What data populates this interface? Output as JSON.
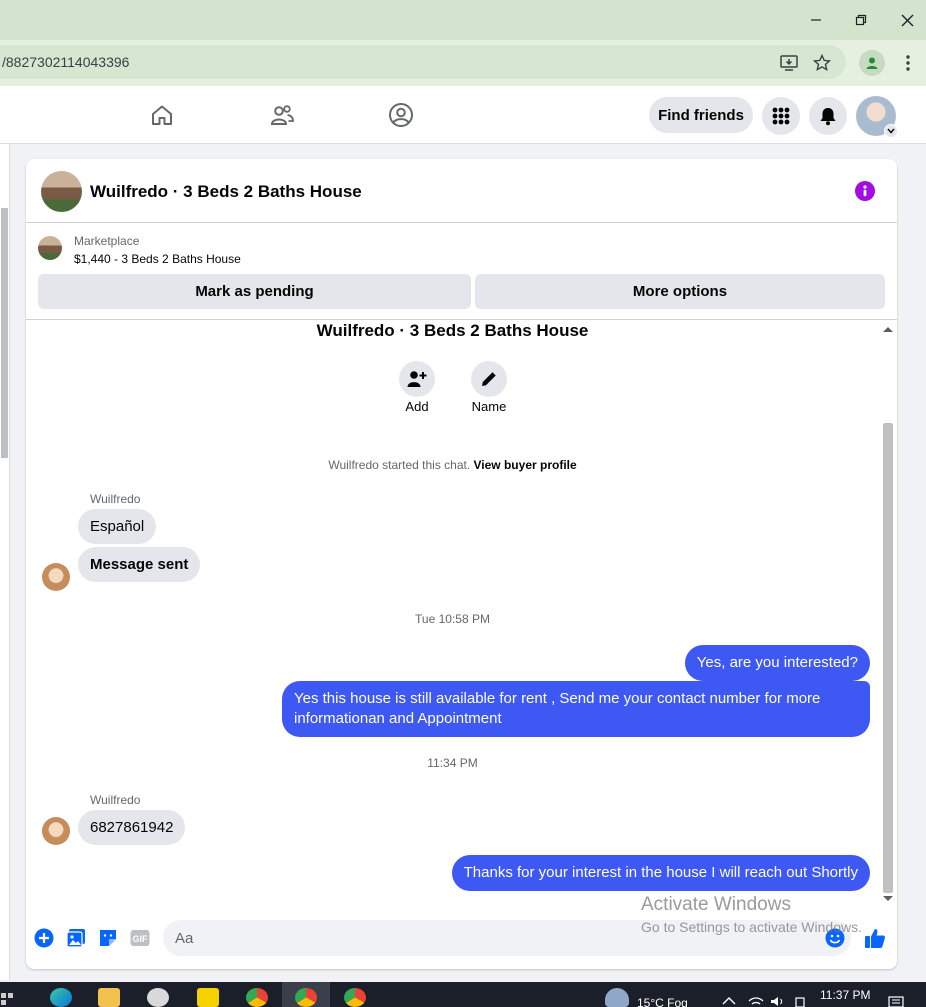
{
  "browser": {
    "url": "/8827302114043396"
  },
  "nav": {
    "find_friends": "Find friends"
  },
  "chat": {
    "title": "Wuilfredo · 3 Beds 2 Baths House",
    "marketplace_label": "Marketplace",
    "listing": "$1,440 - 3 Beds 2 Baths House",
    "mark_pending": "Mark as pending",
    "more_options": "More options",
    "conversation_title": "Wuilfredo · 3 Beds 2 Baths House",
    "add_label": "Add",
    "name_label": "Name",
    "system_note": "Wuilfredo started this chat.",
    "view_profile": "View buyer profile",
    "sender_name": "Wuilfredo",
    "messages_in_1": [
      "Español",
      "Message sent"
    ],
    "timestamp_1": "Tue 10:58 PM",
    "messages_out_1": [
      "Yes, are you interested?",
      "Yes this house is still available for rent , Send me your contact number for more informationan and Appointment"
    ],
    "timestamp_2": "11:34 PM",
    "message_in_2": "6827861942",
    "message_out_2": "Thanks for your interest in the house I will reach out Shortly",
    "composer_placeholder": "Aa",
    "gif_label": "GIF"
  },
  "watermark": {
    "line1": "Activate Windows",
    "line2": "Go to Settings to activate Windows."
  },
  "taskbar": {
    "weather": "15°C  Fog",
    "time": "11:37 PM"
  },
  "colors": {
    "outgoing_bubble": "#3d58f3",
    "incoming_bubble": "#e4e6eb",
    "info_icon": "#a20ee2",
    "accent_blue": "#0866ff"
  }
}
